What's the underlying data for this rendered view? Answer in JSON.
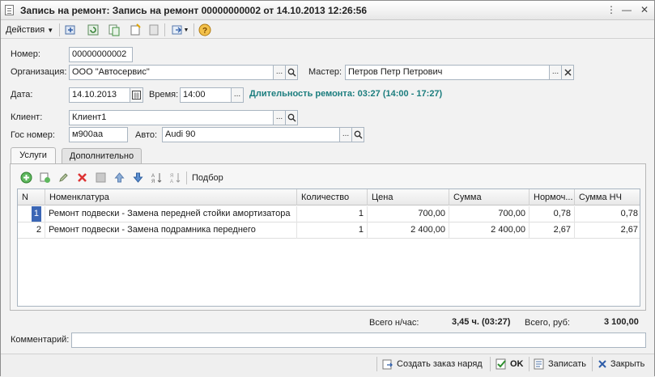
{
  "window": {
    "title": "Запись на ремонт: Запись на ремонт 00000000002 от 14.10.2013 12:26:56"
  },
  "toolbar": {
    "actions_label": "Действия"
  },
  "form": {
    "number_label": "Номер:",
    "number_value": "00000000002",
    "org_label": "Организация:",
    "org_value": "ООО \"Автосервис\"",
    "master_label": "Мастер:",
    "master_value": "Петров Петр Петрович",
    "date_label": "Дата:",
    "date_value": "14.10.2013",
    "time_label": "Время:",
    "time_value": "14:00",
    "duration_text": "Длительность ремонта: 03:27 (14:00 - 17:27)",
    "client_label": "Клиент:",
    "client_value": "Клиент1",
    "plate_label": "Гос номер:",
    "plate_value": "м900аа",
    "auto_label": "Авто:",
    "auto_value": "Audi 90",
    "dots": "...",
    "comment_label": "Комментарий:",
    "comment_value": ""
  },
  "tabs": [
    {
      "label": "Услуги",
      "active": true
    },
    {
      "label": "Дополнительно",
      "active": false
    }
  ],
  "panel_toolbar": {
    "podbor_label": "Подбор"
  },
  "table": {
    "headers": [
      "N",
      "Номенклатура",
      "Количество",
      "Цена",
      "Сумма",
      "Нормоч...",
      "Сумма НЧ"
    ],
    "rows": [
      [
        "1",
        "Ремонт подвески - Замена передней стойки амортизатора",
        "1",
        "700,00",
        "700,00",
        "0,78",
        "0,78"
      ],
      [
        "2",
        "Ремонт подвески - Замена подрамника переднего",
        "1",
        "2 400,00",
        "2 400,00",
        "2,67",
        "2,67"
      ]
    ]
  },
  "totals": {
    "hours_label": "Всего н/час:",
    "hours_value": "3,45 ч. (03:27)",
    "sum_label": "Всего, руб:",
    "sum_value": "3 100,00"
  },
  "footer": {
    "create_order_label": "Создать заказ наряд",
    "ok_label": "OK",
    "save_label": "Записать",
    "close_label": "Закрыть"
  },
  "colors": {
    "accent_teal": "#1b7d7e",
    "selection_blue": "#3b66b5"
  }
}
